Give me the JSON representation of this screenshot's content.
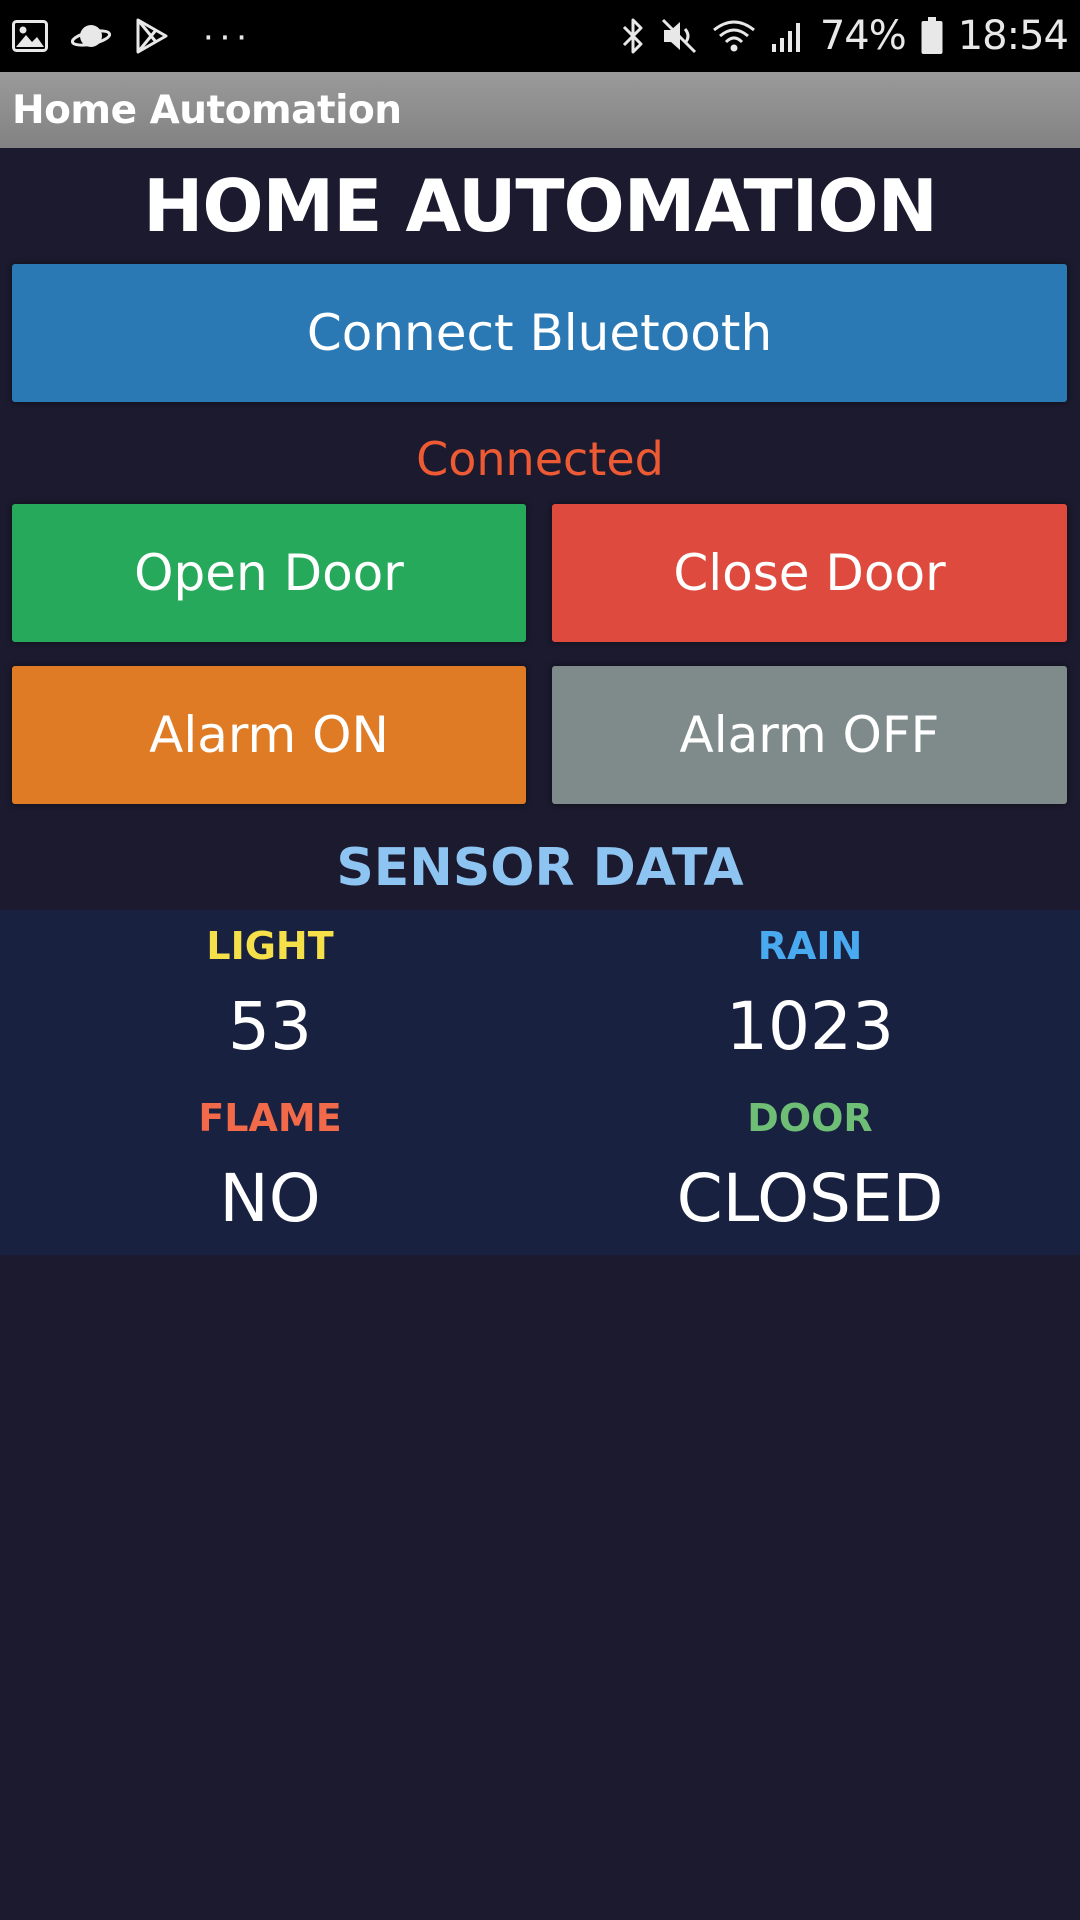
{
  "status_bar": {
    "battery": "74%",
    "time": "18:54",
    "left_icons": [
      "gallery-icon",
      "saturn-icon",
      "play-store-icon",
      "more-dots-icon"
    ],
    "right_icons": [
      "bluetooth-icon",
      "mute-icon",
      "wifi-icon",
      "signal-icon",
      "battery-icon"
    ]
  },
  "app_bar": {
    "title": "Home Automation"
  },
  "main": {
    "title": "HOME AUTOMATION",
    "connect_button": "Connect Bluetooth",
    "connection_status": "Connected",
    "open_door_button": "Open Door",
    "close_door_button": "Close Door",
    "alarm_on_button": "Alarm ON",
    "alarm_off_button": "Alarm OFF"
  },
  "sensors": {
    "heading": "SENSOR DATA",
    "light": {
      "label": "LIGHT",
      "value": "53"
    },
    "rain": {
      "label": "RAIN",
      "value": "1023"
    },
    "flame": {
      "label": "FLAME",
      "value": "NO"
    },
    "door": {
      "label": "DOOR",
      "value": "CLOSED"
    }
  },
  "colors": {
    "background": "#1b1a2e",
    "connect": "#2a79b5",
    "open_door": "#27a95b",
    "close_door": "#de4a3d",
    "alarm_on": "#de7b24",
    "alarm_off": "#7f8b8b",
    "status_connected": "#ee5a33",
    "sensor_heading": "#8ec4f2",
    "light_label": "#f6e04a",
    "rain_label": "#4aaaf0",
    "flame_label": "#f36a4a",
    "door_label": "#6ebf75"
  }
}
